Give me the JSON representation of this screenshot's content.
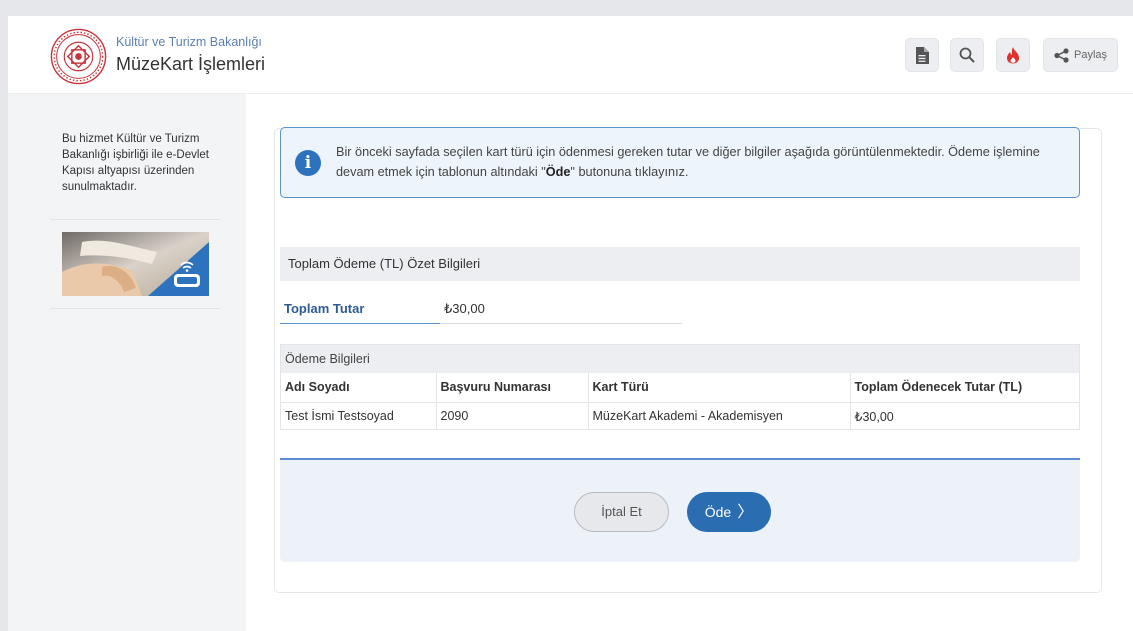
{
  "header": {
    "ministry": "Kültür ve Turizm Bakanlığı",
    "service_title": "MüzeKart İşlemleri",
    "tools": [
      {
        "icon": "document-icon"
      },
      {
        "icon": "search-icon"
      },
      {
        "icon": "fire-icon",
        "color": "#e0312f"
      },
      {
        "icon": "share-icon",
        "label": "Paylaş"
      }
    ]
  },
  "sidebar": {
    "description": "Bu hizmet Kültür ve Turizm Bakanlığı işbirliği ile e-Devlet Kapısı altyapısı üzerinden sunulmaktadır."
  },
  "info": {
    "text_before": "Bir önceki sayfada seçilen kart türü için ödenmesi gereken tutar ve diğer bilgiler aşağıda görüntülenmektedir. Ödeme işlemine devam etmek için tablonun altındaki \"",
    "highlight": "Öde",
    "text_after": "\" butonuna tıklayınız."
  },
  "summary": {
    "heading": "Toplam Ödeme (TL) Özet Bilgileri",
    "total_label": "Toplam Tutar",
    "total_value": "₺30,00"
  },
  "payment": {
    "title": "Ödeme Bilgileri",
    "headers": [
      "Adı Soyadı",
      "Başvuru Numarası",
      "Kart Türü",
      "Toplam Ödenecek Tutar (TL)"
    ],
    "rows": [
      [
        "Test İsmi Testsoyad",
        "2090",
        "MüzeKart Akademi - Akademisyen",
        "₺30,00"
      ]
    ]
  },
  "actions": {
    "cancel_label": "İptal Et",
    "pay_label": "Öde",
    "pay_chevron": "〉"
  },
  "colors": {
    "accent": "#2b6db1",
    "info_border": "#5b93cf",
    "fire": "#e0312f"
  }
}
